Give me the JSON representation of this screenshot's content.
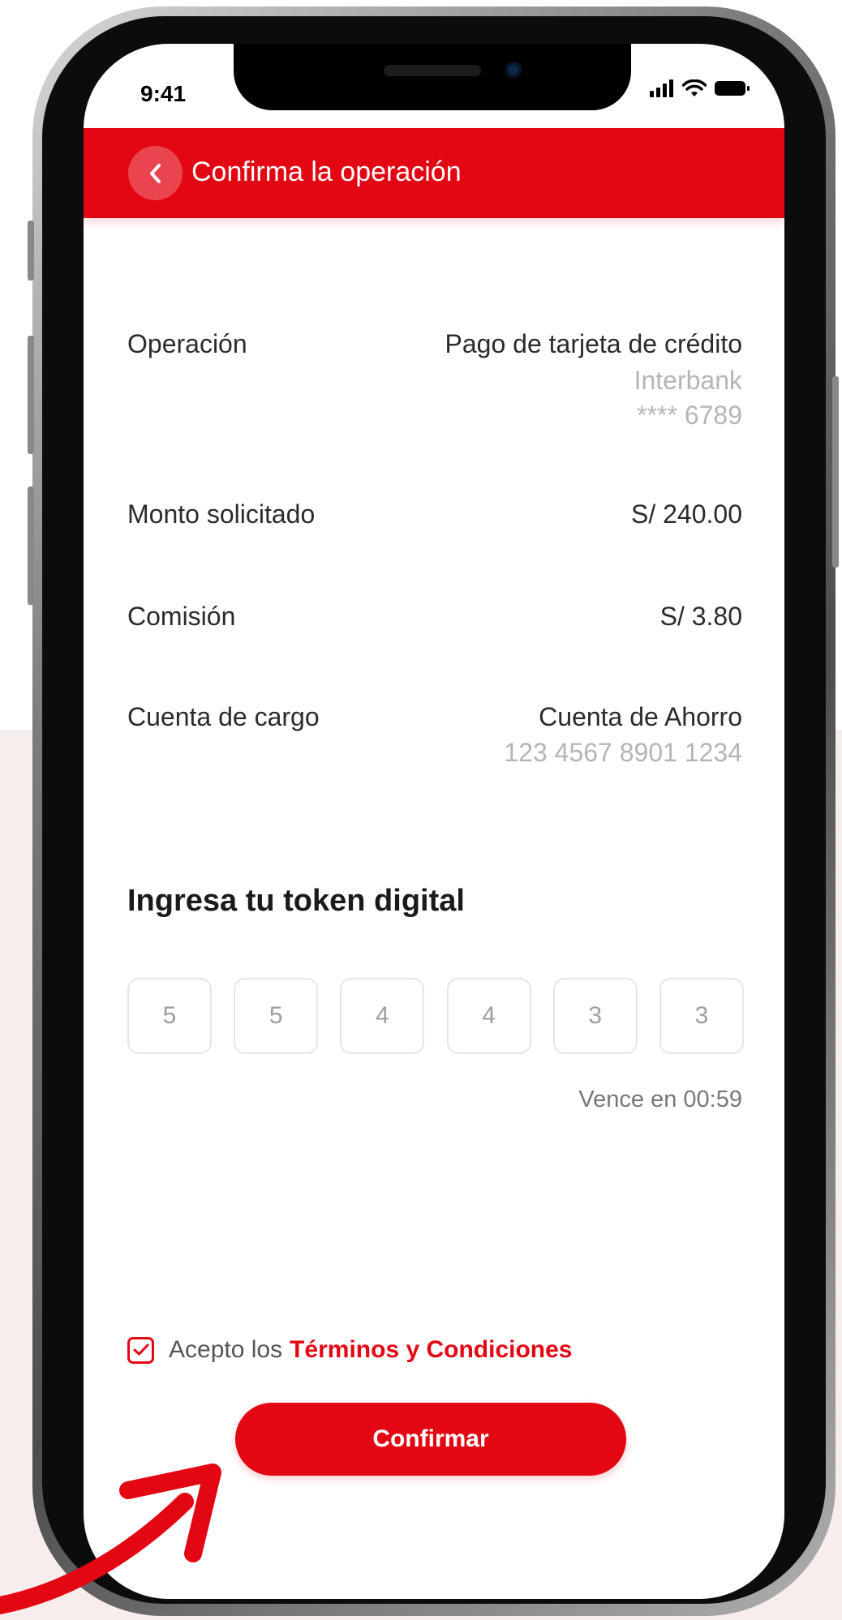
{
  "status_bar": {
    "time": "9:41"
  },
  "header": {
    "title": "Confirma la operación",
    "back_icon": "chevron-left-icon"
  },
  "details": [
    {
      "label": "Operación",
      "value": "Pago de tarjeta de crédito",
      "sub": [
        "Interbank",
        "**** 6789"
      ]
    },
    {
      "label": "Monto solicitado",
      "value": "S/ 240.00",
      "sub": []
    },
    {
      "label": "Comisión",
      "value": "S/ 3.80",
      "sub": []
    },
    {
      "label": "Cuenta de cargo",
      "value": "Cuenta de Ahorro",
      "sub": [
        "123 4567 8901 1234"
      ]
    }
  ],
  "token": {
    "title": "Ingresa tu token digital",
    "digits": [
      "5",
      "5",
      "4",
      "4",
      "3",
      "3"
    ],
    "expires": "Vence en 00:59"
  },
  "terms": {
    "checked": true,
    "prefix": "Acepto los",
    "link": "Términos y Condiciones"
  },
  "confirm_label": "Confirmar",
  "colors": {
    "brand": "#e30613",
    "muted": "#b5b5b5",
    "text": "#2b2b2b"
  }
}
